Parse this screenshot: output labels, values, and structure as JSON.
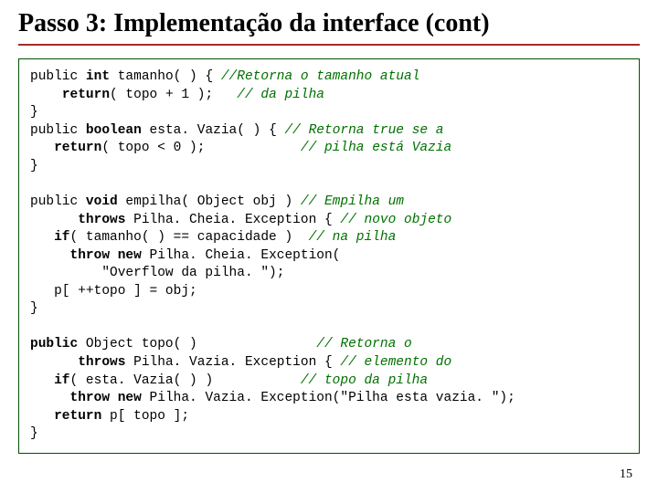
{
  "title": "Passo 3:  Implementação da interface (cont)",
  "page": "15",
  "code": {
    "l1a": "public ",
    "l1b": "int",
    "l1c": " tamanho( ) { ",
    "l1d": "//Retorna o tamanho atual",
    "l2a": "    ",
    "l2b": "return",
    "l2c": "( topo + 1 );   ",
    "l2d": "// da pilha",
    "l3": "}",
    "l4a": "public ",
    "l4b": "boolean",
    "l4c": " esta. Vazia( ) { ",
    "l4d": "// Retorna true se a",
    "l5a": "   ",
    "l5b": "return",
    "l5c": "( topo < 0 );            ",
    "l5d": "// pilha está Vazia",
    "l6": "}",
    "l8a": "public ",
    "l8b": "void",
    "l8c": " empilha( Object obj ) ",
    "l8d": "// Empilha um",
    "l9a": "      ",
    "l9b": "throws",
    "l9c": " Pilha. Cheia. Exception { ",
    "l9d": "// novo objeto",
    "l10a": "   ",
    "l10b": "if",
    "l10c": "( tamanho( ) == capacidade )  ",
    "l10d": "// na pilha",
    "l11a": "     ",
    "l11b": "throw new",
    "l11c": " Pilha. Cheia. Exception(",
    "l12": "         \"Overflow da pilha. \");",
    "l13": "   p[ ++topo ] = obj;",
    "l14": "}",
    "l16a": "public",
    "l16b": " Object topo( )               ",
    "l16d": "// Retorna o",
    "l17a": "      ",
    "l17b": "throws",
    "l17c": " Pilha. Vazia. Exception { ",
    "l17d": "// elemento do",
    "l18a": "   ",
    "l18b": "if",
    "l18c": "( esta. Vazia( ) )           ",
    "l18d": "// topo da pilha",
    "l19a": "     ",
    "l19b": "throw new",
    "l19c": " Pilha. Vazia. Exception(\"Pilha esta vazia. \");",
    "l20a": "   ",
    "l20b": "return",
    "l20c": " p[ topo ];",
    "l21": "}"
  }
}
